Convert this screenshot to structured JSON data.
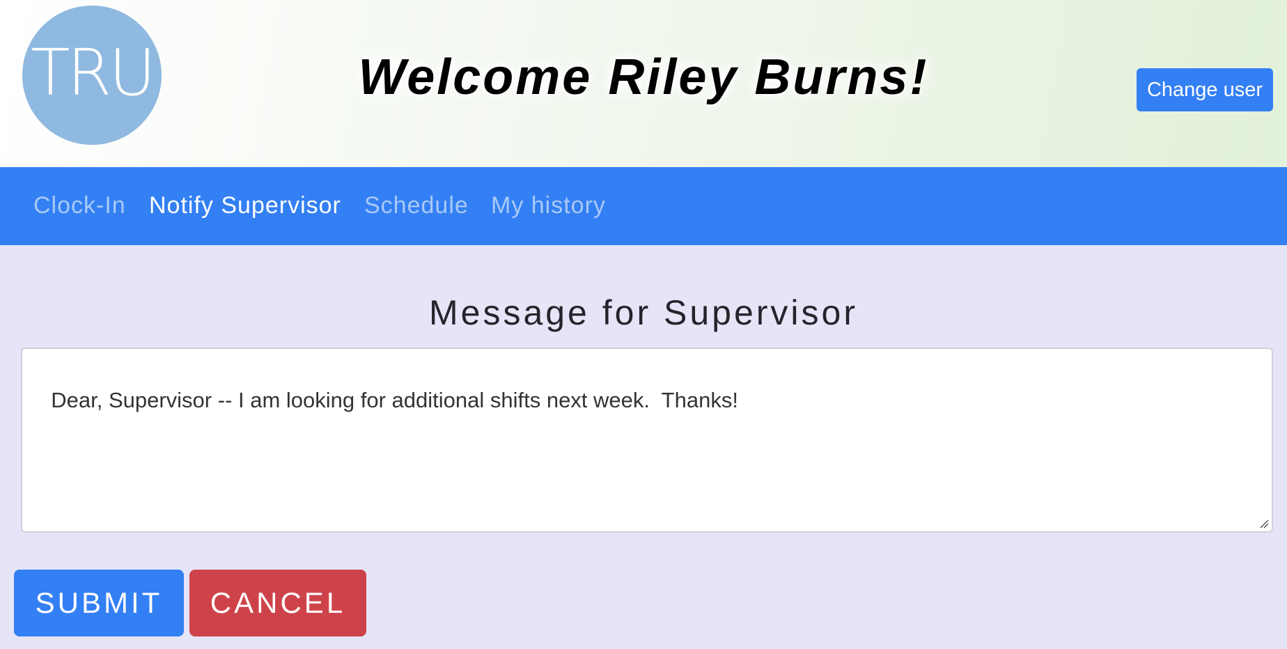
{
  "header": {
    "logo_text": "TRU",
    "welcome_text": "Welcome Riley Burns!",
    "change_user_label": "Change user"
  },
  "nav": {
    "items": [
      {
        "label": "Clock-In",
        "active": false
      },
      {
        "label": "Notify Supervisor",
        "active": true
      },
      {
        "label": "Schedule",
        "active": false
      },
      {
        "label": "My history",
        "active": false
      }
    ]
  },
  "main": {
    "title": "Message for Supervisor",
    "message_value": "Dear, Supervisor -- I am looking for additional shifts next week.  Thanks!",
    "submit_label": "SUBMIT",
    "cancel_label": "CANCEL"
  },
  "colors": {
    "primary": "#337ff4",
    "danger": "#ce434a",
    "background": "#e6e5f8",
    "logo": "#8fb9e0",
    "nav_inactive_text": "#a9c9f7"
  }
}
